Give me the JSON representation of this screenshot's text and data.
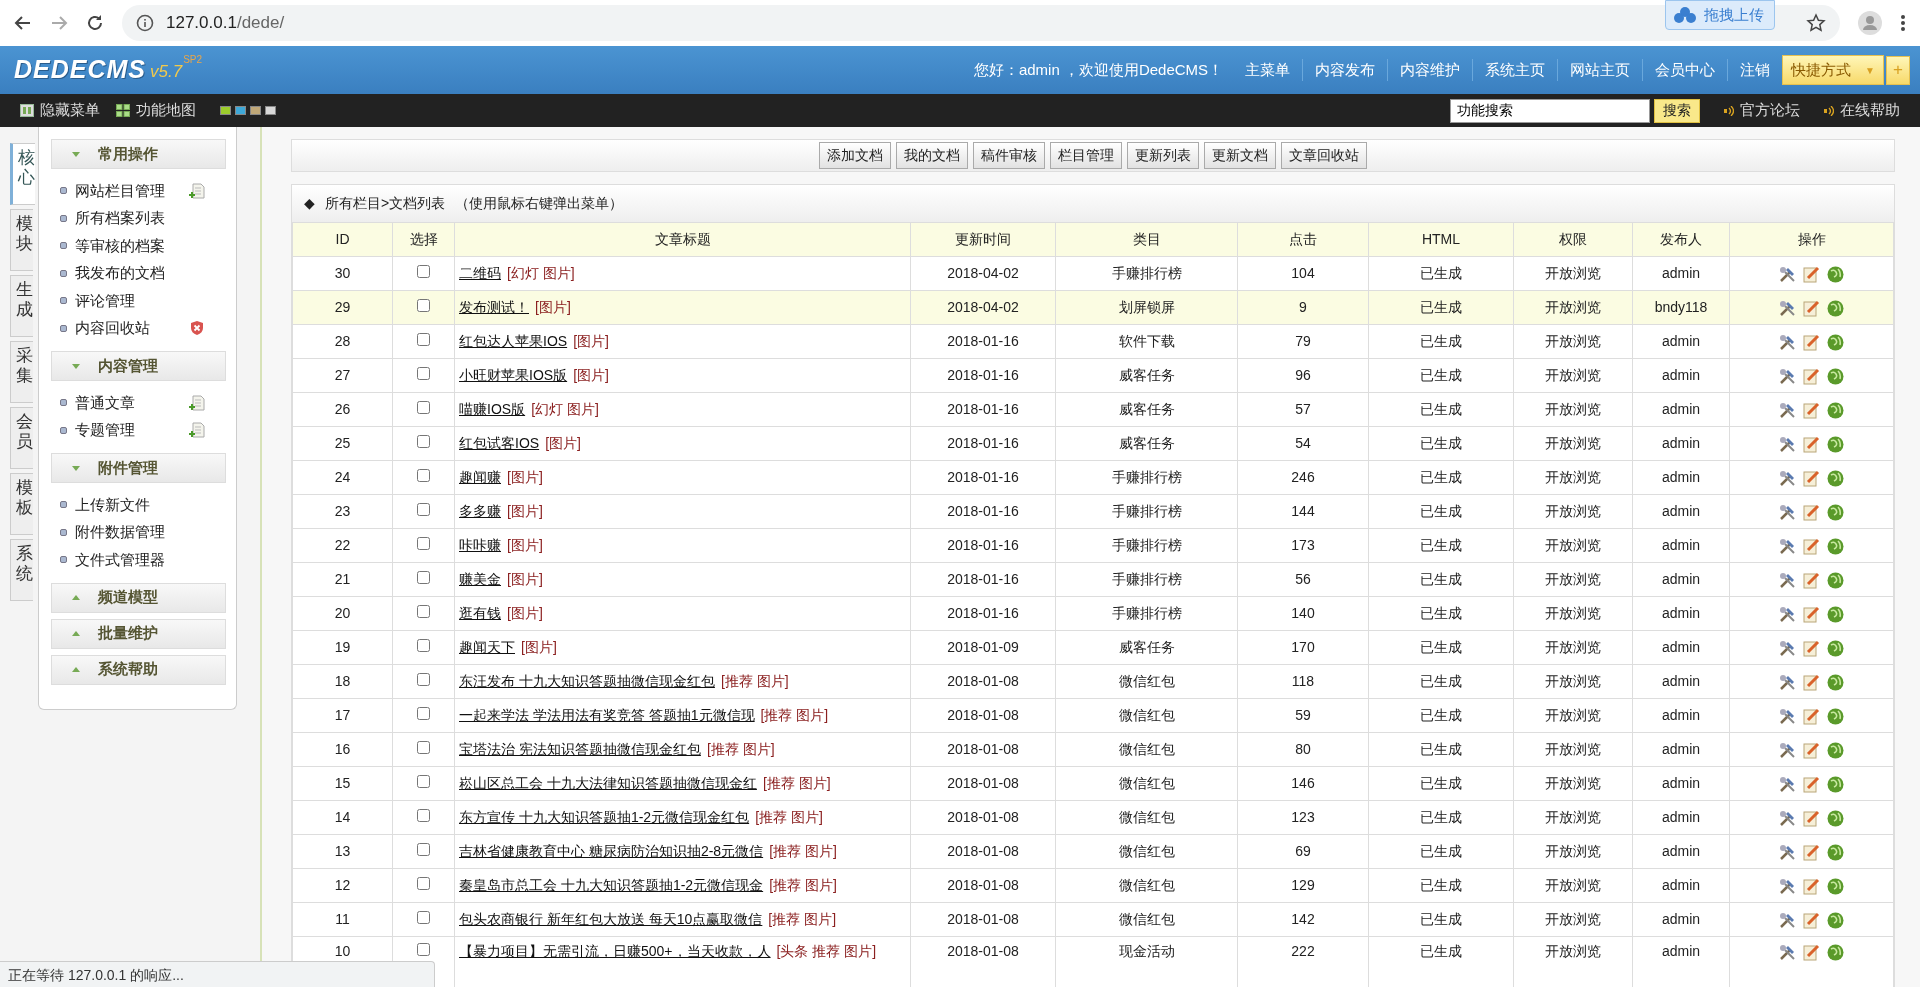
{
  "browser": {
    "url_host": "127.0.0.1",
    "url_path": "/dede/",
    "extension_label": "拖拽上传"
  },
  "header": {
    "logo": "DEDECMS",
    "version": "v5.7",
    "edition": "SP2",
    "greeting": "您好：admin ，欢迎使用DedeCMS！",
    "nav": [
      "主菜单",
      "内容发布",
      "内容维护",
      "系统主页",
      "网站主页",
      "会员中心",
      "注销"
    ],
    "shortcut": {
      "label": "快捷方式",
      "caret": "▼",
      "add": "+"
    }
  },
  "toolbar": {
    "links": [
      {
        "label": "隐藏菜单",
        "kind": "panel"
      },
      {
        "label": "功能地图",
        "kind": "map"
      }
    ],
    "skins": [
      {
        "color": "#9ccc2c"
      },
      {
        "color": "#3ea8d8"
      },
      {
        "color": "#c0a878"
      },
      {
        "color": "#d8d8d8"
      }
    ],
    "search": {
      "value": "功能搜索",
      "button": "搜索"
    },
    "help_links": [
      "官方论坛",
      "在线帮助"
    ]
  },
  "side_tabs": [
    {
      "label": "核心",
      "selected": true
    },
    {
      "label": "模块",
      "selected": false
    },
    {
      "label": "生成",
      "selected": false
    },
    {
      "label": "采集",
      "selected": false
    },
    {
      "label": "会员",
      "selected": false
    },
    {
      "label": "模板",
      "selected": false
    },
    {
      "label": "系统",
      "selected": false
    }
  ],
  "menu": [
    {
      "title": "常用操作",
      "expanded": true,
      "items": [
        {
          "label": "网站栏目管理",
          "kind": "add"
        },
        {
          "label": "所有档案列表",
          "kind": "plain"
        },
        {
          "label": "等审核的档案",
          "kind": "plain"
        },
        {
          "label": "我发布的文档",
          "kind": "plain"
        },
        {
          "label": "评论管理",
          "kind": "plain"
        },
        {
          "label": "内容回收站",
          "kind": "delete"
        }
      ]
    },
    {
      "title": "内容管理",
      "expanded": true,
      "items": [
        {
          "label": "普通文章",
          "kind": "add"
        },
        {
          "label": "专题管理",
          "kind": "add"
        }
      ]
    },
    {
      "title": "附件管理",
      "expanded": true,
      "items": [
        {
          "label": "上传新文件",
          "kind": "plain"
        },
        {
          "label": "附件数据管理",
          "kind": "plain"
        },
        {
          "label": "文件式管理器",
          "kind": "plain"
        }
      ]
    },
    {
      "title": "频道模型",
      "expanded": false
    },
    {
      "title": "批量维护",
      "expanded": false
    },
    {
      "title": "系统帮助",
      "expanded": false
    }
  ],
  "actions": [
    "添加文档",
    "我的文档",
    "稿件审核",
    "栏目管理",
    "更新列表",
    "更新文档",
    "文章回收站"
  ],
  "list": {
    "marker": "◆",
    "breadcrumb": "所有栏目>文档列表",
    "hint": "（使用鼠标右键弹出菜单）",
    "columns": [
      "ID",
      "选择",
      "文章标题",
      "更新时间",
      "类目",
      "点击",
      "HTML",
      "权限",
      "发布人",
      "操作"
    ],
    "rows": [
      {
        "id": "30",
        "checked": false,
        "highlighted": false,
        "title": "二维码",
        "flags": "[幻灯 图片]",
        "date": "2018-04-02",
        "category": "手赚排行榜",
        "clicks": "104",
        "html": "已生成",
        "access": "开放浏览",
        "author": "admin"
      },
      {
        "id": "29",
        "checked": false,
        "highlighted": true,
        "title": "发布测试！",
        "flags": "[图片]",
        "date": "2018-04-02",
        "category": "划屏锁屏",
        "clicks": "9",
        "html": "已生成",
        "access": "开放浏览",
        "author": "bndy118"
      },
      {
        "id": "28",
        "checked": false,
        "highlighted": false,
        "title": "红包达人苹果IOS",
        "flags": "[图片]",
        "date": "2018-01-16",
        "category": "软件下载",
        "clicks": "79",
        "html": "已生成",
        "access": "开放浏览",
        "author": "admin"
      },
      {
        "id": "27",
        "checked": false,
        "highlighted": false,
        "title": "小旺财苹果IOS版",
        "flags": "[图片]",
        "date": "2018-01-16",
        "category": "威客任务",
        "clicks": "96",
        "html": "已生成",
        "access": "开放浏览",
        "author": "admin"
      },
      {
        "id": "26",
        "checked": false,
        "highlighted": false,
        "title": "喵赚IOS版",
        "flags": "[幻灯 图片]",
        "date": "2018-01-16",
        "category": "威客任务",
        "clicks": "57",
        "html": "已生成",
        "access": "开放浏览",
        "author": "admin"
      },
      {
        "id": "25",
        "checked": false,
        "highlighted": false,
        "title": "红包试客IOS",
        "flags": "[图片]",
        "date": "2018-01-16",
        "category": "威客任务",
        "clicks": "54",
        "html": "已生成",
        "access": "开放浏览",
        "author": "admin"
      },
      {
        "id": "24",
        "checked": false,
        "highlighted": false,
        "title": "趣闻赚",
        "flags": "[图片]",
        "date": "2018-01-16",
        "category": "手赚排行榜",
        "clicks": "246",
        "html": "已生成",
        "access": "开放浏览",
        "author": "admin"
      },
      {
        "id": "23",
        "checked": false,
        "highlighted": false,
        "title": "多多赚",
        "flags": "[图片]",
        "date": "2018-01-16",
        "category": "手赚排行榜",
        "clicks": "144",
        "html": "已生成",
        "access": "开放浏览",
        "author": "admin"
      },
      {
        "id": "22",
        "checked": false,
        "highlighted": false,
        "title": "咔咔赚",
        "flags": "[图片]",
        "date": "2018-01-16",
        "category": "手赚排行榜",
        "clicks": "173",
        "html": "已生成",
        "access": "开放浏览",
        "author": "admin"
      },
      {
        "id": "21",
        "checked": false,
        "highlighted": false,
        "title": "赚美金",
        "flags": "[图片]",
        "date": "2018-01-16",
        "category": "手赚排行榜",
        "clicks": "56",
        "html": "已生成",
        "access": "开放浏览",
        "author": "admin"
      },
      {
        "id": "20",
        "checked": false,
        "highlighted": false,
        "title": "逛有钱",
        "flags": "[图片]",
        "date": "2018-01-16",
        "category": "手赚排行榜",
        "clicks": "140",
        "html": "已生成",
        "access": "开放浏览",
        "author": "admin"
      },
      {
        "id": "19",
        "checked": false,
        "highlighted": false,
        "title": "趣闻天下",
        "flags": "[图片]",
        "date": "2018-01-09",
        "category": "威客任务",
        "clicks": "170",
        "html": "已生成",
        "access": "开放浏览",
        "author": "admin"
      },
      {
        "id": "18",
        "checked": false,
        "highlighted": false,
        "title": "东汪发布 十九大知识答题抽微信现金红包",
        "flags": "[推荐 图片]",
        "date": "2018-01-08",
        "category": "微信红包",
        "clicks": "118",
        "html": "已生成",
        "access": "开放浏览",
        "author": "admin"
      },
      {
        "id": "17",
        "checked": false,
        "highlighted": false,
        "title": "一起来学法 学法用法有奖竞答 答题抽1元微信现",
        "flags": "[推荐 图片]",
        "date": "2018-01-08",
        "category": "微信红包",
        "clicks": "59",
        "html": "已生成",
        "access": "开放浏览",
        "author": "admin"
      },
      {
        "id": "16",
        "checked": false,
        "highlighted": false,
        "title": "宝塔法治 宪法知识答题抽微信现金红包",
        "flags": "[推荐 图片]",
        "date": "2018-01-08",
        "category": "微信红包",
        "clicks": "80",
        "html": "已生成",
        "access": "开放浏览",
        "author": "admin"
      },
      {
        "id": "15",
        "checked": false,
        "highlighted": false,
        "title": "崧山区总工会 十九大法律知识答题抽微信现金红",
        "flags": "[推荐 图片]",
        "date": "2018-01-08",
        "category": "微信红包",
        "clicks": "146",
        "html": "已生成",
        "access": "开放浏览",
        "author": "admin"
      },
      {
        "id": "14",
        "checked": false,
        "highlighted": false,
        "title": "东方宣传 十九大知识答题抽1-2元微信现金红包",
        "flags": "[推荐 图片]",
        "date": "2018-01-08",
        "category": "微信红包",
        "clicks": "123",
        "html": "已生成",
        "access": "开放浏览",
        "author": "admin"
      },
      {
        "id": "13",
        "checked": false,
        "highlighted": false,
        "title": "吉林省健康教育中心 糖尿病防治知识抽2-8元微信",
        "flags": "[推荐 图片]",
        "date": "2018-01-08",
        "category": "微信红包",
        "clicks": "69",
        "html": "已生成",
        "access": "开放浏览",
        "author": "admin"
      },
      {
        "id": "12",
        "checked": false,
        "highlighted": false,
        "title": "秦皇岛市总工会 十九大知识答题抽1-2元微信现金",
        "flags": "[推荐 图片]",
        "date": "2018-01-08",
        "category": "微信红包",
        "clicks": "129",
        "html": "已生成",
        "access": "开放浏览",
        "author": "admin"
      },
      {
        "id": "11",
        "checked": false,
        "highlighted": false,
        "title": "包头农商银行 新年红包大放送 每天10点赢取微信",
        "flags": "[推荐 图片]",
        "date": "2018-01-08",
        "category": "微信红包",
        "clicks": "142",
        "html": "已生成",
        "access": "开放浏览",
        "author": "admin"
      },
      {
        "id": "10",
        "checked": false,
        "highlighted": false,
        "title": "【暴力项目】无需引流，日赚500+，当天收款，人",
        "flags": "[头条 推荐 图片]",
        "date": "2018-01-08",
        "category": "现金活动",
        "clicks": "222",
        "html": "已生成",
        "access": "开放浏览",
        "author": "admin"
      }
    ]
  },
  "status_bar": "正在等待 127.0.0.1 的响应..."
}
